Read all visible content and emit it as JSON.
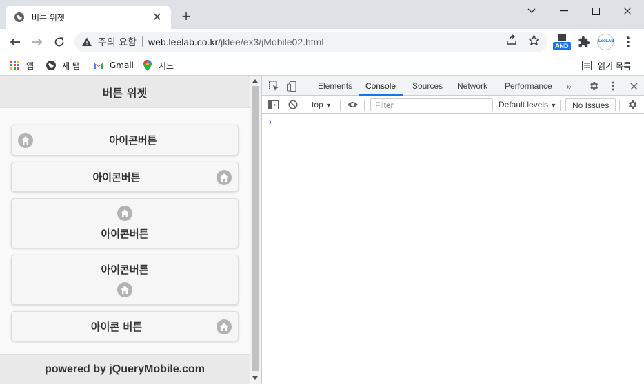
{
  "browser": {
    "tab_title": "버튼 위젯",
    "security_label": "주의 요함",
    "url_host": "web.leelab.co.kr",
    "url_path": "/jklee/ex3/jMobile02.html",
    "ext_and_label": "AND",
    "ext_leelab_label": "LeeLAB"
  },
  "bookmarks": {
    "apps": "앱",
    "new_tab": "새 탭",
    "gmail": "Gmail",
    "maps": "지도",
    "reading_list": "읽기 목록"
  },
  "page": {
    "header_title": "버튼 위젯",
    "buttons": [
      {
        "label": "아이콘버튼",
        "icon_pos": "left",
        "icon": "home-icon"
      },
      {
        "label": "아이콘버튼",
        "icon_pos": "right",
        "icon": "home-icon"
      },
      {
        "label": "아이콘버튼",
        "icon_pos": "top",
        "icon": "home-icon"
      },
      {
        "label": "아이콘버튼",
        "icon_pos": "bottom",
        "icon": "home-icon"
      },
      {
        "label": "아이콘 버튼",
        "icon_pos": "right",
        "icon": "home-icon"
      }
    ],
    "footer_text": "powered by jQueryMobile.com"
  },
  "devtools": {
    "tabs": [
      "Elements",
      "Console",
      "Sources",
      "Network",
      "Performance"
    ],
    "active_tab": "Console",
    "context": "top",
    "filter_placeholder": "Filter",
    "levels": "Default levels",
    "issues": "No Issues",
    "prompt": "›"
  },
  "colors": {
    "accent": "#1a73e8",
    "chrome_bg": "#dee1e6",
    "icon_disc": "#b3b3b3"
  }
}
